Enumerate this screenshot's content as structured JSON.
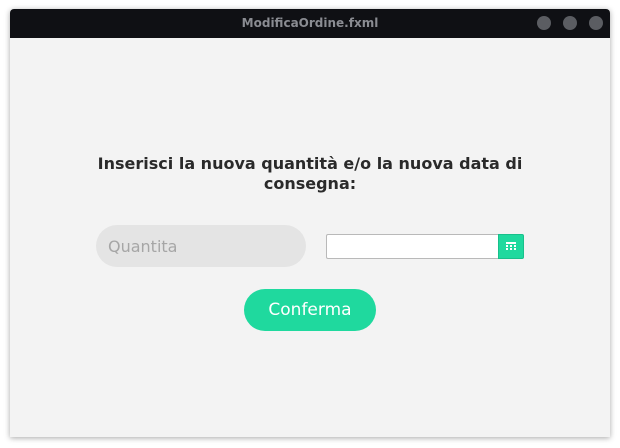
{
  "window": {
    "title": "ModificaOrdine.fxml"
  },
  "form": {
    "prompt": "Inserisci la nuova quantità e/o la nuova data di consegna:",
    "quantity": {
      "placeholder": "Quantita",
      "value": ""
    },
    "date": {
      "value": "",
      "icon": "calendar-icon"
    },
    "confirm_label": "Conferma"
  },
  "colors": {
    "accent": "#1fd99e",
    "titlebar": "#0f1014",
    "background": "#f3f3f3",
    "input_background": "#e4e4e4"
  }
}
